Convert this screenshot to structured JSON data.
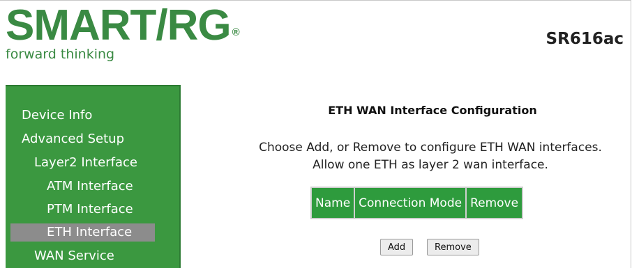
{
  "header": {
    "logo_text": "SMART/RG",
    "logo_reg": "®",
    "tagline": "forward thinking",
    "model": "SR616ac"
  },
  "sidebar": {
    "items": [
      {
        "label": "Device Info",
        "level": 0,
        "selected": false
      },
      {
        "label": "Advanced Setup",
        "level": 0,
        "selected": false
      },
      {
        "label": "Layer2 Interface",
        "level": 1,
        "selected": false
      },
      {
        "label": "ATM Interface",
        "level": 2,
        "selected": false
      },
      {
        "label": "PTM Interface",
        "level": 2,
        "selected": false
      },
      {
        "label": "ETH Interface",
        "level": 2,
        "selected": true
      },
      {
        "label": "WAN Service",
        "level": 1,
        "selected": false
      }
    ]
  },
  "main": {
    "title": "ETH WAN Interface Configuration",
    "description_line1": "Choose Add, or Remove to configure ETH WAN interfaces.",
    "description_line2": "Allow one ETH as layer 2 wan interface.",
    "table": {
      "headers": [
        "Name",
        "Connection Mode",
        "Remove"
      ]
    },
    "buttons": {
      "add": "Add",
      "remove": "Remove"
    }
  },
  "colors": {
    "brand_green": "#3a8a43",
    "sidebar_green": "#3b9840",
    "table_header_green": "#2e9b3d",
    "selected_gray": "#8c8c8c"
  }
}
